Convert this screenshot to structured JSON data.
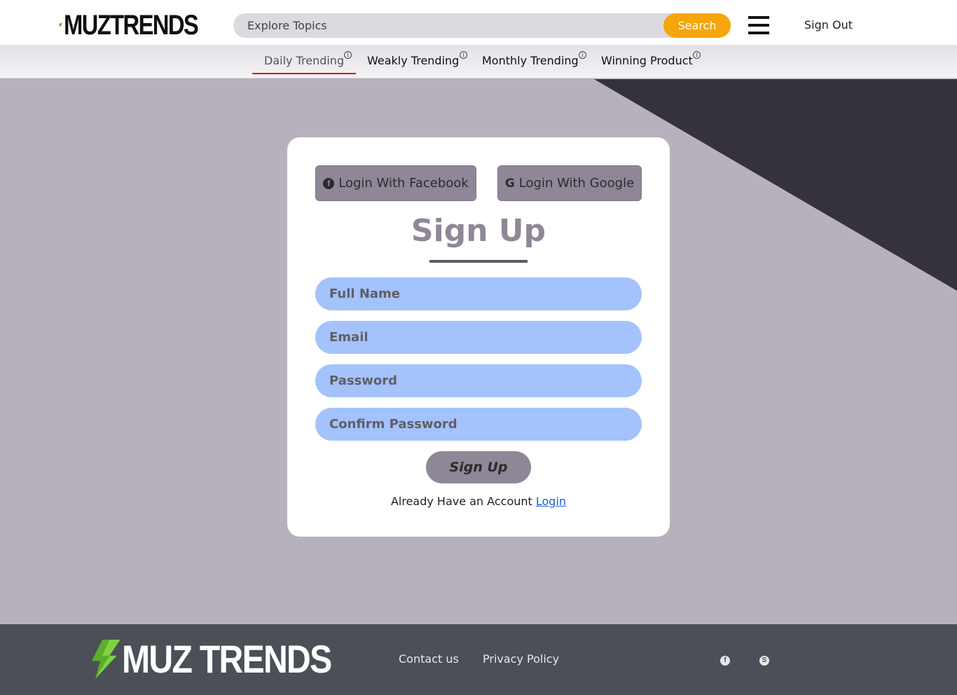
{
  "header": {
    "logo_text": "MUZTRENDS",
    "search_placeholder": "Explore Topics",
    "search_button": "Search",
    "signout_label": "Sign Out"
  },
  "nav": {
    "items": [
      {
        "label": "Daily Trending",
        "active": true
      },
      {
        "label": "Weakly Trending"
      },
      {
        "label": "Monthly Trending"
      },
      {
        "label": "Winning Product"
      }
    ],
    "info_glyph": "i"
  },
  "signup": {
    "facebook_button": "Login With Facebook",
    "google_button": "Login With Google",
    "title": "Sign Up",
    "fields": {
      "full_name_placeholder": "Full Name",
      "email_placeholder": "Email",
      "password_placeholder": "Password",
      "confirm_password_placeholder": "Confirm Password"
    },
    "submit_label": "Sign Up",
    "account_prompt": "Already Have an Account",
    "login_link": "Login"
  },
  "footer": {
    "logo_text": "MUZ TRENDS",
    "links": [
      "Contact us",
      "Privacy Policy"
    ],
    "social_icons": [
      "facebook-icon",
      "skype-icon"
    ]
  },
  "colors": {
    "background": "#b7b1bd",
    "accent_orange": "#f5a60a",
    "button_purple": "#8f8798",
    "field_blue": "#a4c2fb",
    "footer": "#4b4f57",
    "active_underline": "#dd1111"
  }
}
